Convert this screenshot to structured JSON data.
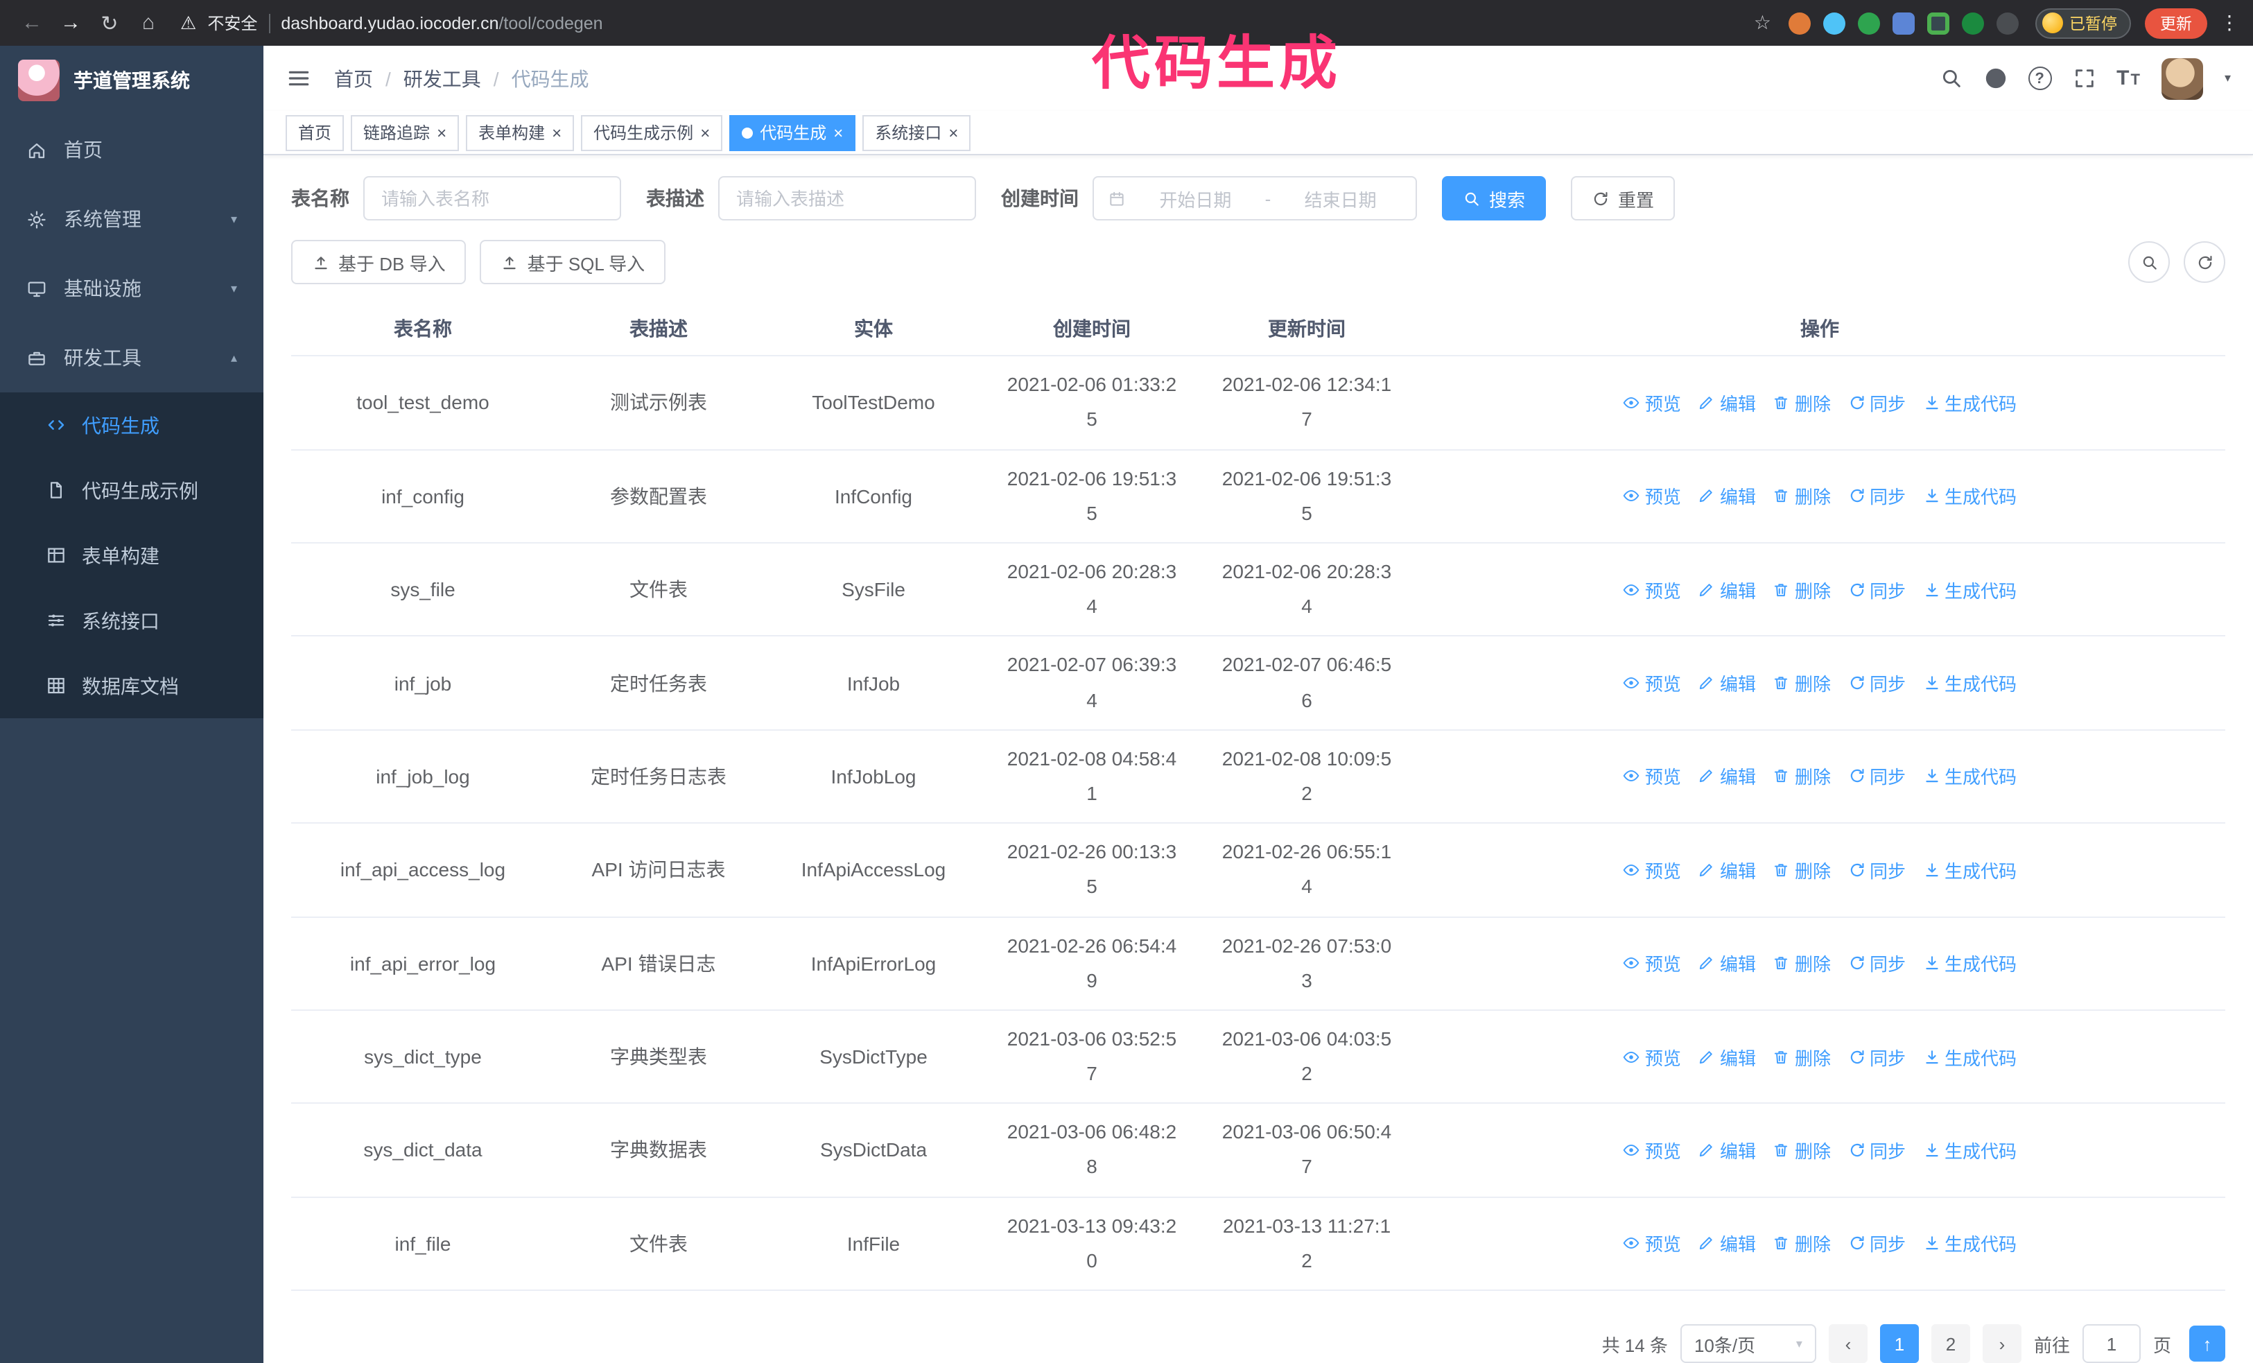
{
  "annotation": {
    "text": "代码生成"
  },
  "browser": {
    "security_label": "不安全",
    "url_host": "dashboard.yudao.iocoder.cn",
    "url_path": "/tool/codegen",
    "paused_badge": "已暂停",
    "update_button": "更新"
  },
  "sidebar": {
    "logo_title": "芋道管理系统",
    "items": [
      {
        "label": "首页"
      },
      {
        "label": "系统管理"
      },
      {
        "label": "基础设施"
      },
      {
        "label": "研发工具"
      }
    ],
    "submenu": [
      {
        "label": "代码生成"
      },
      {
        "label": "代码生成示例"
      },
      {
        "label": "表单构建"
      },
      {
        "label": "系统接口"
      },
      {
        "label": "数据库文档"
      }
    ]
  },
  "breadcrumb": [
    "首页",
    "研发工具",
    "代码生成"
  ],
  "tabs": [
    {
      "label": "首页"
    },
    {
      "label": "链路追踪"
    },
    {
      "label": "表单构建"
    },
    {
      "label": "代码生成示例"
    },
    {
      "label": "代码生成"
    },
    {
      "label": "系统接口"
    }
  ],
  "filters": {
    "table_name_label": "表名称",
    "table_name_placeholder": "请输入表名称",
    "table_desc_label": "表描述",
    "table_desc_placeholder": "请输入表描述",
    "create_time_label": "创建时间",
    "date_start_placeholder": "开始日期",
    "date_separator": "-",
    "date_end_placeholder": "结束日期",
    "search_button": "搜索",
    "reset_button": "重置"
  },
  "toolbar": {
    "import_db": "基于 DB 导入",
    "import_sql": "基于 SQL 导入"
  },
  "table": {
    "columns": [
      "表名称",
      "表描述",
      "实体",
      "创建时间",
      "更新时间",
      "操作"
    ],
    "actions": {
      "preview": "预览",
      "edit": "编辑",
      "delete": "删除",
      "sync": "同步",
      "generate": "生成代码"
    },
    "rows": [
      {
        "name": "tool_test_demo",
        "desc": "测试示例表",
        "entity": "ToolTestDemo",
        "created": "2021-02-06 01:33:25",
        "updated": "2021-02-06 12:34:17"
      },
      {
        "name": "inf_config",
        "desc": "参数配置表",
        "entity": "InfConfig",
        "created": "2021-02-06 19:51:35",
        "updated": "2021-02-06 19:51:35"
      },
      {
        "name": "sys_file",
        "desc": "文件表",
        "entity": "SysFile",
        "created": "2021-02-06 20:28:34",
        "updated": "2021-02-06 20:28:34"
      },
      {
        "name": "inf_job",
        "desc": "定时任务表",
        "entity": "InfJob",
        "created": "2021-02-07 06:39:34",
        "updated": "2021-02-07 06:46:56"
      },
      {
        "name": "inf_job_log",
        "desc": "定时任务日志表",
        "entity": "InfJobLog",
        "created": "2021-02-08 04:58:41",
        "updated": "2021-02-08 10:09:52"
      },
      {
        "name": "inf_api_access_log",
        "desc": "API 访问日志表",
        "entity": "InfApiAccessLog",
        "created": "2021-02-26 00:13:35",
        "updated": "2021-02-26 06:55:14"
      },
      {
        "name": "inf_api_error_log",
        "desc": "API 错误日志",
        "entity": "InfApiErrorLog",
        "created": "2021-02-26 06:54:49",
        "updated": "2021-02-26 07:53:03"
      },
      {
        "name": "sys_dict_type",
        "desc": "字典类型表",
        "entity": "SysDictType",
        "created": "2021-03-06 03:52:57",
        "updated": "2021-03-06 04:03:52"
      },
      {
        "name": "sys_dict_data",
        "desc": "字典数据表",
        "entity": "SysDictData",
        "created": "2021-03-06 06:48:28",
        "updated": "2021-03-06 06:50:47"
      },
      {
        "name": "inf_file",
        "desc": "文件表",
        "entity": "InfFile",
        "created": "2021-03-13 09:43:20",
        "updated": "2021-03-13 11:27:12"
      }
    ]
  },
  "pagination": {
    "total": "共 14 条",
    "page_size": "10条/页",
    "page_1": "1",
    "page_2": "2",
    "goto_prefix": "前往",
    "goto_value": "1",
    "goto_suffix": "页"
  },
  "colors": {
    "accent": "#409eff",
    "annotation": "#fa3473",
    "sidebar_bg": "#304156",
    "submenu_bg": "#1f2d3d",
    "link": "#409eff"
  }
}
